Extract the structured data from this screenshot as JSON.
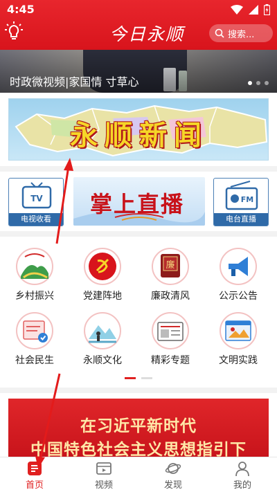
{
  "status_bar": {
    "time": "4:45"
  },
  "header": {
    "logo_text": "今日永顺",
    "search_placeholder": "搜索..."
  },
  "news_banner": {
    "caption": "时政微视频|家国情 寸草心",
    "slide_count": 3,
    "active_slide": 1
  },
  "map_banner": {
    "title": "永顺新闻"
  },
  "entries": {
    "tv_label": "电视收看",
    "tv_icon_text": "TV",
    "live_text": "掌上直播",
    "radio_label": "电台直播",
    "radio_icon_text": "FM"
  },
  "grid": [
    {
      "label": "乡村振兴",
      "icon": "village-icon"
    },
    {
      "label": "党建阵地",
      "icon": "party-emblem-icon"
    },
    {
      "label": "廉政清风",
      "icon": "integrity-icon"
    },
    {
      "label": "公示公告",
      "icon": "megaphone-icon"
    },
    {
      "label": "社会民生",
      "icon": "livelihood-icon"
    },
    {
      "label": "永顺文化",
      "icon": "culture-icon"
    },
    {
      "label": "精彩专题",
      "icon": "topic-icon"
    },
    {
      "label": "文明实践",
      "icon": "civilization-icon"
    }
  ],
  "integrity_icon_text": "廉",
  "pager": {
    "pages": 2,
    "active": 1
  },
  "promo": {
    "line1": "在习近平新时代",
    "line2": "中国特色社会主义思想指引下"
  },
  "bottom_nav": [
    {
      "label": "首页",
      "icon": "home-icon",
      "active": true
    },
    {
      "label": "视频",
      "icon": "video-icon",
      "active": false
    },
    {
      "label": "发现",
      "icon": "planet-icon",
      "active": false
    },
    {
      "label": "我的",
      "icon": "user-icon",
      "active": false
    }
  ],
  "colors": {
    "brand_red": "#e02020",
    "tile_blue": "#2f6aa8",
    "title_yellow": "#f6d628"
  }
}
